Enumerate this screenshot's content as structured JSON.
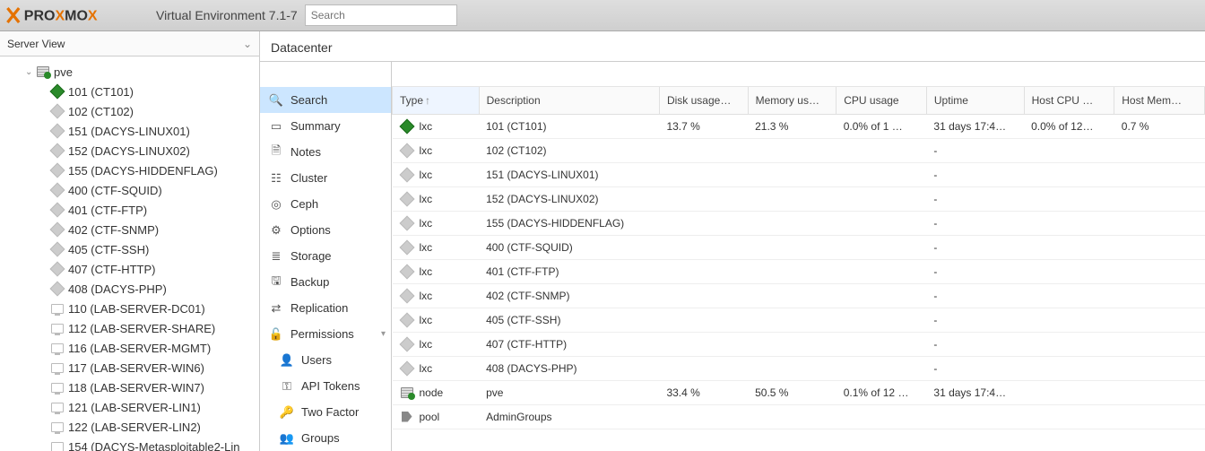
{
  "header": {
    "suite_label": "Virtual Environment 7.1-7",
    "search_placeholder": "Search"
  },
  "view_selector": {
    "label": "Server View"
  },
  "tree": {
    "root": {
      "label": "pve"
    },
    "children": [
      {
        "label": "101 (CT101)",
        "kind": "lxc",
        "running": true
      },
      {
        "label": "102 (CT102)",
        "kind": "lxc",
        "running": false
      },
      {
        "label": "151 (DACYS-LINUX01)",
        "kind": "lxc",
        "running": false
      },
      {
        "label": "152 (DACYS-LINUX02)",
        "kind": "lxc",
        "running": false
      },
      {
        "label": "155 (DACYS-HIDDENFLAG)",
        "kind": "lxc",
        "running": false
      },
      {
        "label": "400 (CTF-SQUID)",
        "kind": "lxc",
        "running": false
      },
      {
        "label": "401 (CTF-FTP)",
        "kind": "lxc",
        "running": false
      },
      {
        "label": "402 (CTF-SNMP)",
        "kind": "lxc",
        "running": false
      },
      {
        "label": "405 (CTF-SSH)",
        "kind": "lxc",
        "running": false
      },
      {
        "label": "407 (CTF-HTTP)",
        "kind": "lxc",
        "running": false
      },
      {
        "label": "408 (DACYS-PHP)",
        "kind": "lxc",
        "running": false
      },
      {
        "label": "110 (LAB-SERVER-DC01)",
        "kind": "vm",
        "running": false
      },
      {
        "label": "112 (LAB-SERVER-SHARE)",
        "kind": "vm",
        "running": false
      },
      {
        "label": "116 (LAB-SERVER-MGMT)",
        "kind": "vm",
        "running": false
      },
      {
        "label": "117 (LAB-SERVER-WIN6)",
        "kind": "vm",
        "running": false
      },
      {
        "label": "118 (LAB-SERVER-WIN7)",
        "kind": "vm",
        "running": false
      },
      {
        "label": "121 (LAB-SERVER-LIN1)",
        "kind": "vm",
        "running": false
      },
      {
        "label": "122 (LAB-SERVER-LIN2)",
        "kind": "vm",
        "running": false
      },
      {
        "label": "154 (DACYS-Metasploitable2-Lin",
        "kind": "vm",
        "running": false
      }
    ]
  },
  "breadcrumb": "Datacenter",
  "nav": {
    "items": [
      {
        "label": "Search",
        "icon": "search",
        "selected": true
      },
      {
        "label": "Summary",
        "icon": "summary"
      },
      {
        "label": "Notes",
        "icon": "notes"
      },
      {
        "label": "Cluster",
        "icon": "cluster"
      },
      {
        "label": "Ceph",
        "icon": "ceph"
      },
      {
        "label": "Options",
        "icon": "options"
      },
      {
        "label": "Storage",
        "icon": "storage"
      },
      {
        "label": "Backup",
        "icon": "backup"
      },
      {
        "label": "Replication",
        "icon": "replication"
      },
      {
        "label": "Permissions",
        "icon": "permissions",
        "has_sub": true
      },
      {
        "label": "Users",
        "icon": "users",
        "sub": true
      },
      {
        "label": "API Tokens",
        "icon": "tokens",
        "sub": true
      },
      {
        "label": "Two Factor",
        "icon": "twofactor",
        "sub": true
      },
      {
        "label": "Groups",
        "icon": "groups",
        "sub": true
      }
    ]
  },
  "grid": {
    "columns": {
      "type": "Type",
      "description": "Description",
      "disk": "Disk usage…",
      "memory": "Memory us…",
      "cpu": "CPU usage",
      "uptime": "Uptime",
      "hostcpu": "Host CPU …",
      "hostmem": "Host Mem…"
    },
    "rows": [
      {
        "type": "lxc",
        "icon": "lxc-run",
        "desc": "101 (CT101)",
        "disk": "13.7 %",
        "mem": "21.3 %",
        "cpu": "0.0% of 1 …",
        "uptime": "31 days 17:4…",
        "hcpu": "0.0% of 12…",
        "hmem": "0.7 %"
      },
      {
        "type": "lxc",
        "icon": "lxc",
        "desc": "102 (CT102)",
        "disk": "",
        "mem": "",
        "cpu": "",
        "uptime": "-",
        "hcpu": "",
        "hmem": ""
      },
      {
        "type": "lxc",
        "icon": "lxc",
        "desc": "151 (DACYS-LINUX01)",
        "disk": "",
        "mem": "",
        "cpu": "",
        "uptime": "-",
        "hcpu": "",
        "hmem": ""
      },
      {
        "type": "lxc",
        "icon": "lxc",
        "desc": "152 (DACYS-LINUX02)",
        "disk": "",
        "mem": "",
        "cpu": "",
        "uptime": "-",
        "hcpu": "",
        "hmem": ""
      },
      {
        "type": "lxc",
        "icon": "lxc",
        "desc": "155 (DACYS-HIDDENFLAG)",
        "disk": "",
        "mem": "",
        "cpu": "",
        "uptime": "-",
        "hcpu": "",
        "hmem": ""
      },
      {
        "type": "lxc",
        "icon": "lxc",
        "desc": "400 (CTF-SQUID)",
        "disk": "",
        "mem": "",
        "cpu": "",
        "uptime": "-",
        "hcpu": "",
        "hmem": ""
      },
      {
        "type": "lxc",
        "icon": "lxc",
        "desc": "401 (CTF-FTP)",
        "disk": "",
        "mem": "",
        "cpu": "",
        "uptime": "-",
        "hcpu": "",
        "hmem": ""
      },
      {
        "type": "lxc",
        "icon": "lxc",
        "desc": "402 (CTF-SNMP)",
        "disk": "",
        "mem": "",
        "cpu": "",
        "uptime": "-",
        "hcpu": "",
        "hmem": ""
      },
      {
        "type": "lxc",
        "icon": "lxc",
        "desc": "405 (CTF-SSH)",
        "disk": "",
        "mem": "",
        "cpu": "",
        "uptime": "-",
        "hcpu": "",
        "hmem": ""
      },
      {
        "type": "lxc",
        "icon": "lxc",
        "desc": "407 (CTF-HTTP)",
        "disk": "",
        "mem": "",
        "cpu": "",
        "uptime": "-",
        "hcpu": "",
        "hmem": ""
      },
      {
        "type": "lxc",
        "icon": "lxc",
        "desc": "408 (DACYS-PHP)",
        "disk": "",
        "mem": "",
        "cpu": "",
        "uptime": "-",
        "hcpu": "",
        "hmem": ""
      },
      {
        "type": "node",
        "icon": "node",
        "desc": "pve",
        "disk": "33.4 %",
        "mem": "50.5 %",
        "cpu": "0.1% of 12 …",
        "uptime": "31 days 17:4…",
        "hcpu": "",
        "hmem": ""
      },
      {
        "type": "pool",
        "icon": "pool",
        "desc": "AdminGroups",
        "disk": "",
        "mem": "",
        "cpu": "",
        "uptime": "",
        "hcpu": "",
        "hmem": ""
      }
    ]
  }
}
